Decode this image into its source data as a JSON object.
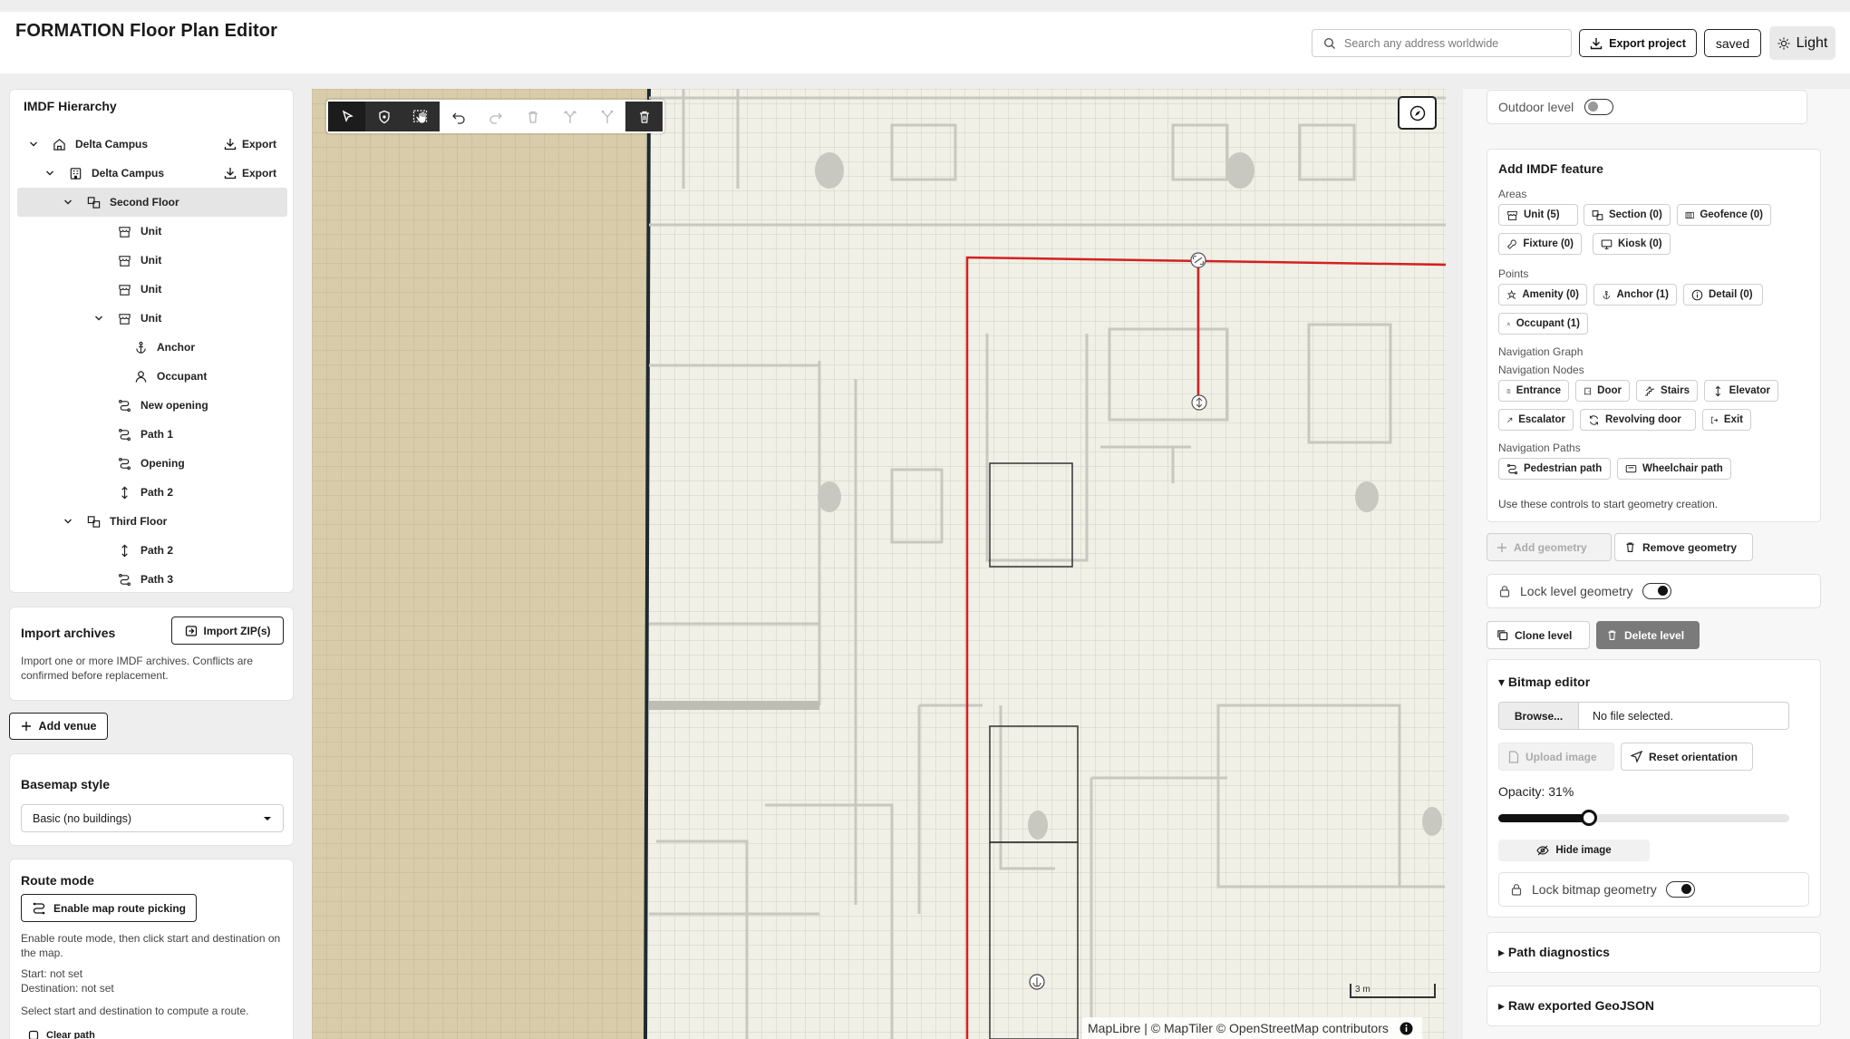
{
  "header": {
    "title": "FORMATION Floor Plan Editor",
    "search_placeholder": "Search any address worldwide",
    "export_label": "Export project",
    "saved_label": "saved",
    "theme_label": "Light"
  },
  "tree": {
    "title": "IMDF Hierarchy",
    "export_label": "Export",
    "items": [
      {
        "label": "Delta Campus",
        "icon": "venue-icon",
        "depth": 0,
        "expanded": true,
        "export": true
      },
      {
        "label": "Delta Campus",
        "icon": "building-icon",
        "depth": 1,
        "expanded": true,
        "export": true
      },
      {
        "label": "Second Floor",
        "icon": "level-icon",
        "depth": 2,
        "expanded": true,
        "selected": true
      },
      {
        "label": "Unit",
        "icon": "unit-icon",
        "depth": 3
      },
      {
        "label": "Unit",
        "icon": "unit-icon",
        "depth": 3
      },
      {
        "label": "Unit",
        "icon": "unit-icon",
        "depth": 3
      },
      {
        "label": "Unit",
        "icon": "unit-icon",
        "depth": 3,
        "expanded": true
      },
      {
        "label": "Anchor",
        "icon": "anchor-icon",
        "depth": 4
      },
      {
        "label": "Occupant",
        "icon": "occupant-icon",
        "depth": 4
      },
      {
        "label": "New opening",
        "icon": "opening-icon",
        "depth": 3
      },
      {
        "label": "Path 1",
        "icon": "path-icon",
        "depth": 3
      },
      {
        "label": "Opening",
        "icon": "opening-icon",
        "depth": 3
      },
      {
        "label": "Path 2",
        "icon": "vertical-path-icon",
        "depth": 3
      },
      {
        "label": "Third Floor",
        "icon": "level-icon",
        "depth": 2,
        "expanded": true
      },
      {
        "label": "Path 2",
        "icon": "vertical-path-icon",
        "depth": 3
      },
      {
        "label": "Path 3",
        "icon": "path-icon",
        "depth": 3
      }
    ]
  },
  "import": {
    "title": "Import archives",
    "button": "Import ZIP(s)",
    "help": "Import one or more IMDF archives. Conflicts are confirmed before replacement."
  },
  "add_venue_label": "Add venue",
  "basemap": {
    "title": "Basemap style",
    "selected": "Basic (no buildings)"
  },
  "route": {
    "title": "Route mode",
    "button": "Enable map route picking",
    "help": "Enable route mode, then click start and destination on the map.",
    "start": "Start: not set",
    "destination": "Destination: not set",
    "hint": "Select start and destination to compute a route.",
    "clear": "Clear path"
  },
  "map": {
    "attribution": "MapLibre | © MapTiler © OpenStreetMap contributors",
    "scale_label": "3 m",
    "toolbar": [
      "select-tool",
      "shield-tool",
      "pan-tool",
      "undo",
      "redo",
      "delete",
      "split",
      "merge",
      "trash"
    ]
  },
  "right": {
    "outdoor_label": "Outdoor level",
    "feature": {
      "title": "Add IMDF feature",
      "areas_label": "Areas",
      "areas": [
        {
          "label": "Unit (5)",
          "icon": "unit-icon"
        },
        {
          "label": "Section (0)",
          "icon": "section-icon"
        },
        {
          "label": "Geofence (0)",
          "icon": "geofence-icon"
        },
        {
          "label": "Fixture (0)",
          "icon": "fixture-icon"
        },
        {
          "label": "Kiosk (0)",
          "icon": "kiosk-icon"
        }
      ],
      "points_label": "Points",
      "points": [
        {
          "label": "Amenity (0)",
          "icon": "amenity-icon"
        },
        {
          "label": "Anchor (1)",
          "icon": "anchor-icon"
        },
        {
          "label": "Detail (0)",
          "icon": "detail-icon"
        },
        {
          "label": "Occupant (1)",
          "icon": "occupant-icon"
        }
      ],
      "nav_graph_label": "Navigation Graph",
      "nav_nodes_label": "Navigation Nodes",
      "nodes": [
        {
          "label": "Entrance",
          "icon": "entrance-icon"
        },
        {
          "label": "Door",
          "icon": "door-icon"
        },
        {
          "label": "Stairs",
          "icon": "stairs-icon"
        },
        {
          "label": "Elevator",
          "icon": "elevator-icon"
        },
        {
          "label": "Escalator",
          "icon": "escalator-icon"
        },
        {
          "label": "Revolving door",
          "icon": "revolving-door-icon"
        },
        {
          "label": "Exit",
          "icon": "exit-icon"
        }
      ],
      "nav_paths_label": "Navigation Paths",
      "paths": [
        {
          "label": "Pedestrian path",
          "icon": "path-icon"
        },
        {
          "label": "Wheelchair path",
          "icon": "wheelchair-icon"
        }
      ],
      "help": "Use these controls to start geometry creation."
    },
    "add_geometry_label": "Add geometry",
    "remove_geometry_label": "Remove geometry",
    "lock_level_label": "Lock level geometry",
    "clone_level_label": "Clone level",
    "delete_level_label": "Delete level",
    "bitmap": {
      "title": "▾ Bitmap editor",
      "browse_label": "Browse...",
      "file_status": "No file selected.",
      "upload_label": "Upload image",
      "reset_label": "Reset orientation",
      "opacity_label": "Opacity: 31%",
      "opacity": 0.31,
      "hide_label": "Hide image",
      "lock_label": "Lock bitmap geometry"
    },
    "path_diagnostics_label": "▸ Path diagnostics",
    "raw_geojson_label": "▸ Raw exported GeoJSON"
  }
}
